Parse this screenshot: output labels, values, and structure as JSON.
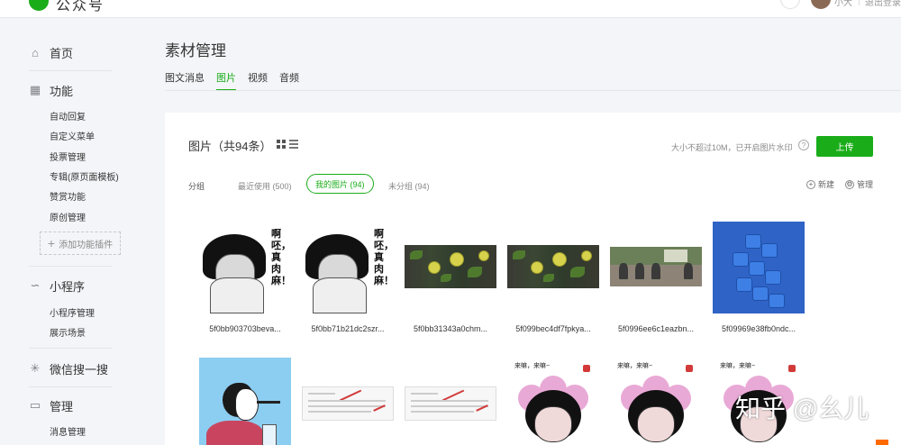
{
  "header": {
    "logo_text": "公众号",
    "user_name": "小大",
    "logout": "退出登录"
  },
  "sidebar": {
    "home": "首页",
    "groups": [
      {
        "title": "功能",
        "items": [
          "自动回复",
          "自定义菜单",
          "投票管理",
          "专辑(原页面模板)",
          "赞赏功能",
          "原创管理"
        ]
      },
      {
        "title": "小程序",
        "items": [
          "小程序管理",
          "展示场景"
        ]
      },
      {
        "title": "微信搜一搜",
        "items": []
      },
      {
        "title": "管理",
        "items": [
          "消息管理"
        ]
      }
    ],
    "add_plugin": "添加功能插件"
  },
  "page": {
    "title": "素材管理",
    "tabs": [
      "图文消息",
      "图片",
      "视频",
      "音频"
    ],
    "active_tab": "图片"
  },
  "panel": {
    "title": "图片（共94条）",
    "upload_hint": "大小不超过10M，已开启图片水印",
    "help_icon": "?",
    "upload_button": "上传",
    "group_label": "分组",
    "filters": [
      "最近使用 (500)",
      "我的图片 (94)",
      "未分组 (94)"
    ],
    "active_filter": "我的图片 (94)",
    "new_label": "新建",
    "manage_label": "管理"
  },
  "images": [
    {
      "caption": "5f0bb903703beva...",
      "kind": "meme",
      "text": "啊呸，真肉麻！"
    },
    {
      "caption": "5f0bb71b21dc2szr...",
      "kind": "meme",
      "text": "啊呸，真肉麻！"
    },
    {
      "caption": "5f0bb31343a0chm...",
      "kind": "food"
    },
    {
      "caption": "5f099bec4df7fpkya...",
      "kind": "food"
    },
    {
      "caption": "5f0996ee6c1eazbn...",
      "kind": "meeting"
    },
    {
      "caption": "5f09969e38fb0ndc...",
      "kind": "blocks"
    },
    {
      "caption": "",
      "kind": "portrait"
    },
    {
      "caption": "",
      "kind": "doc"
    },
    {
      "caption": "",
      "kind": "doc"
    },
    {
      "caption": "",
      "kind": "flower",
      "text": "来嘛，来嘛~"
    },
    {
      "caption": "",
      "kind": "flower",
      "text": "来嘛，来嘛~"
    },
    {
      "caption": "",
      "kind": "flower",
      "text": "来嘛，来嘛~"
    }
  ],
  "watermark": "知乎 @幺儿",
  "colors": {
    "accent": "#1aad19",
    "background": "#f4f5f9"
  }
}
